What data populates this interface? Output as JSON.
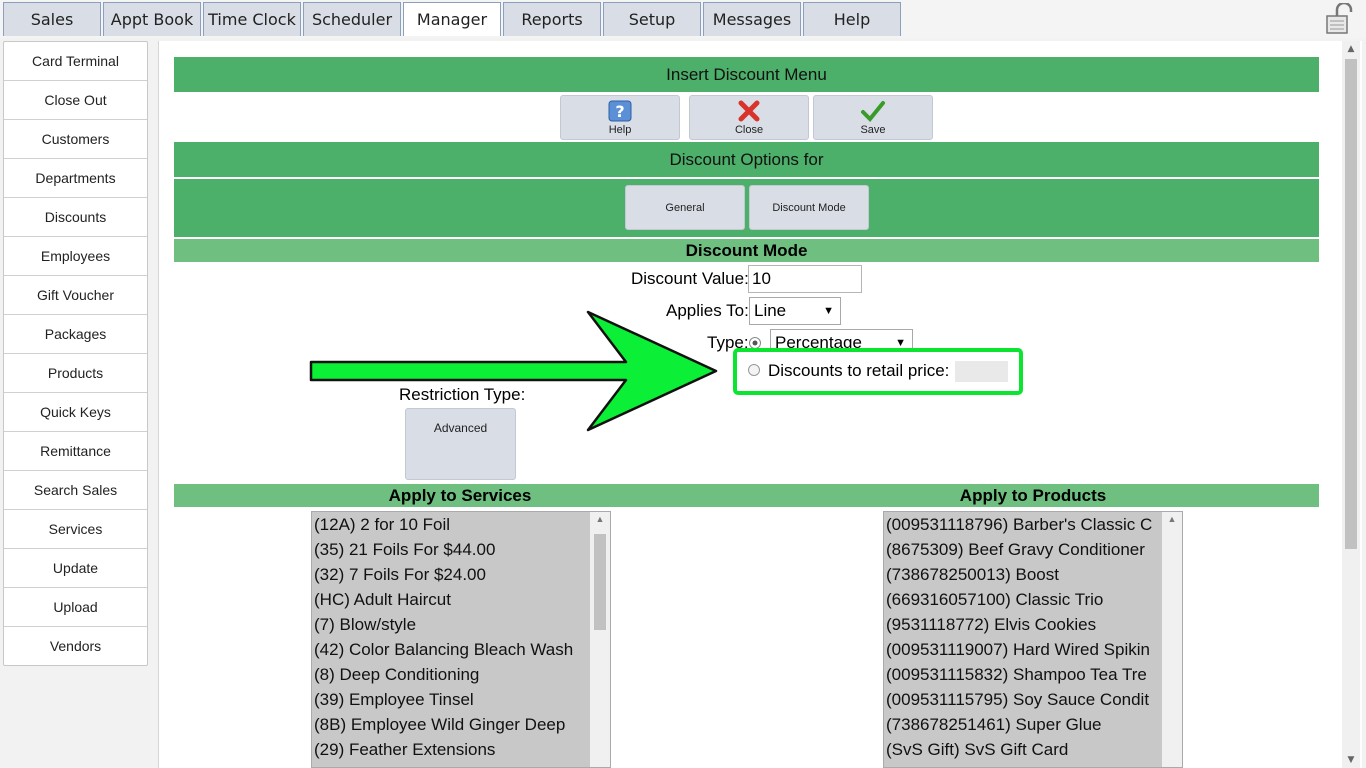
{
  "tabs": [
    "Sales",
    "Appt Book",
    "Time Clock",
    "Scheduler",
    "Manager",
    "Reports",
    "Setup",
    "Messages",
    "Help"
  ],
  "active_tab": "Manager",
  "sidebar": {
    "items": [
      "Card Terminal",
      "Close Out",
      "Customers",
      "Departments",
      "Discounts",
      "Employees",
      "Gift Voucher",
      "Packages",
      "Products",
      "Quick Keys",
      "Remittance",
      "Search Sales",
      "Services",
      "Update",
      "Upload",
      "Vendors"
    ]
  },
  "header": {
    "title": "Insert Discount Menu",
    "help_label": "Help",
    "close_label": "Close",
    "save_label": "Save"
  },
  "options": {
    "title": "Discount Options for",
    "general_label": "General",
    "mode_label": "Discount Mode"
  },
  "mode": {
    "section_title": "Discount Mode",
    "value_label": "Discount Value:",
    "value": "10",
    "applies_label": "Applies To:",
    "applies_value": "Line",
    "type_label": "Type:",
    "type_value": "Percentage",
    "retail_label": "Discounts to retail price:",
    "restriction_label": "Restriction Type:",
    "advanced_label": "Advanced"
  },
  "services": {
    "title": "Apply to Services",
    "items": [
      "(12A)  2 for 10 Foil",
      "(35)  21 Foils For $44.00",
      "(32)  7 Foils For $24.00",
      "(HC)  Adult Haircut",
      "(7)  Blow/style",
      "(42)  Color Balancing Bleach Wash",
      "(8)  Deep Conditioning",
      "(39)  Employee Tinsel",
      "(8B)  Employee Wild Ginger Deep",
      "(29)  Feather Extensions"
    ]
  },
  "products": {
    "title": "Apply to Products",
    "items": [
      "(009531118796)  Barber's Classic C",
      "(8675309)  Beef Gravy Conditioner",
      "(738678250013)  Boost",
      "(669316057100)  Classic Trio",
      "(9531118772)  Elvis Cookies",
      "(009531119007)  Hard Wired Spikin",
      "(009531115832)  Shampoo Tea Tre",
      "(009531115795)  Soy Sauce Condit",
      "(738678251461)  Super Glue",
      "(SvS Gift)  SvS Gift Card"
    ]
  },
  "colors": {
    "green_header": "#4caf6a",
    "light_green": "#6fbf80",
    "highlight": "#0be530"
  }
}
